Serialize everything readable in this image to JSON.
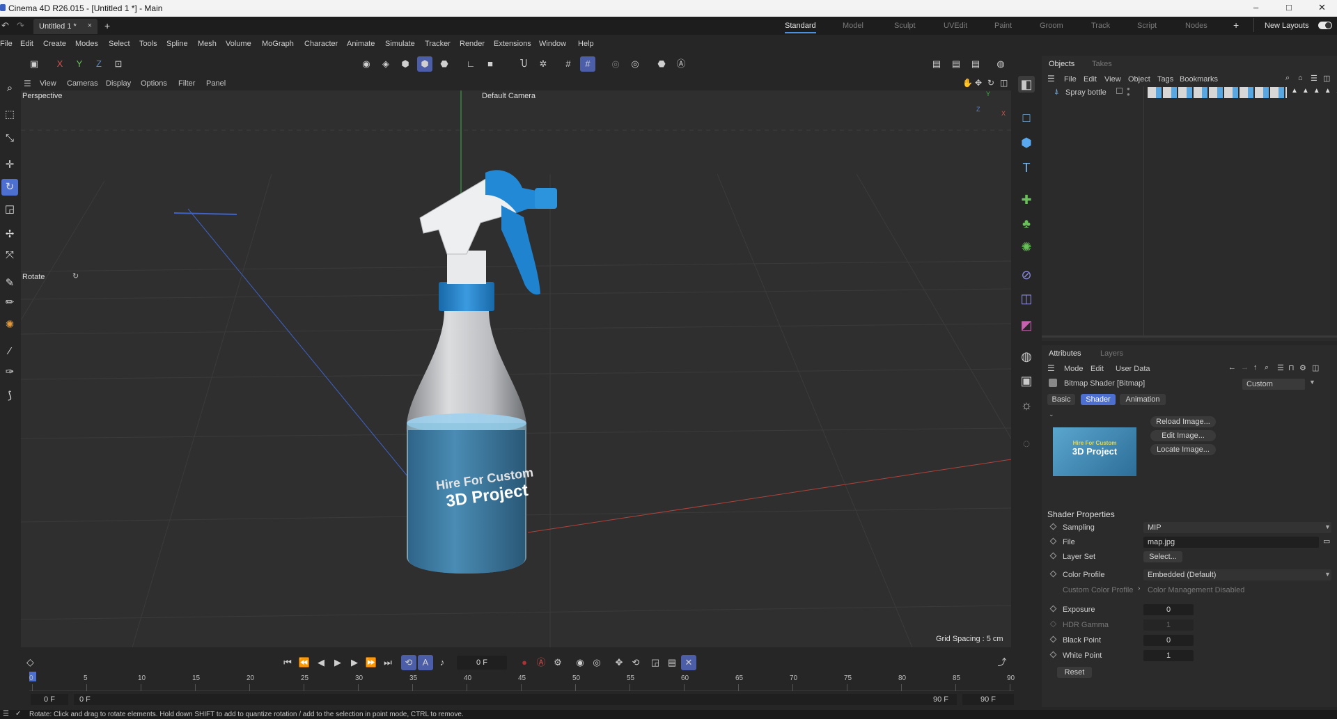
{
  "window": {
    "title": "Cinema 4D R26.015 - [Untitled 1 *] - Main",
    "min": "–",
    "max": "□",
    "close": "✕"
  },
  "tabbar": {
    "doc_tab": "Untitled 1 *",
    "doc_close": "×",
    "add": "+",
    "layouts": [
      "Standard",
      "Model",
      "Sculpt",
      "UVEdit",
      "Paint",
      "Groom",
      "Track",
      "Script",
      "Nodes"
    ],
    "layouts_add": "+",
    "new_layouts": "New Layouts"
  },
  "menu": [
    "File",
    "Edit",
    "Create",
    "Modes",
    "Select",
    "Tools",
    "Spline",
    "Mesh",
    "Volume",
    "MoGraph",
    "Character",
    "Animate",
    "Simulate",
    "Tracker",
    "Render",
    "Extensions",
    "Window",
    "Help"
  ],
  "toolbar": {
    "x": "X",
    "y": "Y",
    "z": "Z"
  },
  "viewport_menu": [
    "View",
    "Cameras",
    "Display",
    "Options",
    "Filter",
    "Panel"
  ],
  "viewport": {
    "name": "Perspective",
    "camera": "Default Camera",
    "tool_label": "Rotate",
    "grid_spacing": "Grid Spacing : 5 cm",
    "label_line1": "Hire For Custom",
    "label_line2": "3D Project",
    "axis_y": "Y",
    "axis_z": "Z",
    "axis_x": "X"
  },
  "objects": {
    "tabs": [
      "Objects",
      "Takes"
    ],
    "menu": [
      "File",
      "Edit",
      "View",
      "Object",
      "Tags",
      "Bookmarks"
    ],
    "item": "Spray bottle"
  },
  "attributes": {
    "tabs": [
      "Attributes",
      "Layers"
    ],
    "menu": [
      "Mode",
      "Edit",
      "User Data"
    ],
    "header": "Bitmap Shader [Bitmap]",
    "preset": "Custom",
    "subtabs": [
      "Basic",
      "Shader",
      "Animation"
    ],
    "image_buttons": [
      "Reload Image...",
      "Edit Image...",
      "Locate Image..."
    ],
    "thumb_line1": "Hire For Custom",
    "thumb_line2": "3D Project",
    "section": "Shader Properties",
    "props": {
      "sampling": {
        "label": "Sampling",
        "value": "MIP"
      },
      "file": {
        "label": "File",
        "value": "map.jpg"
      },
      "layer_set": {
        "label": "Layer Set",
        "value": "Select..."
      },
      "color_profile": {
        "label": "Color Profile",
        "value": "Embedded (Default)"
      },
      "custom_color_profile": {
        "label": "Custom Color Profile",
        "value": "Color Management Disabled"
      },
      "exposure": {
        "label": "Exposure",
        "value": "0"
      },
      "hdr_gamma": {
        "label": "HDR Gamma",
        "value": "1"
      },
      "black_point": {
        "label": "Black Point",
        "value": "0"
      },
      "white_point": {
        "label": "White Point",
        "value": "1"
      }
    },
    "reset": "Reset"
  },
  "timeline": {
    "current_frame": "0 F",
    "ticks": [
      "0",
      "5",
      "10",
      "15",
      "20",
      "25",
      "30",
      "35",
      "40",
      "45",
      "50",
      "55",
      "60",
      "65",
      "70",
      "75",
      "80",
      "85",
      "90"
    ],
    "range_start": "0 F",
    "range_start2": "0 F",
    "range_end": "90 F",
    "range_end2": "90 F"
  },
  "status": "Rotate: Click and drag to rotate elements. Hold down SHIFT to add to quantize rotation / add to the selection in point mode, CTRL to remove.",
  "colors": {
    "accent": "#4d6fd0",
    "bottle_label": "#3f7fa6",
    "trigger_blue": "#1f83d0",
    "grid_x_axis": "#b0443c",
    "grid_z_axis": "#3f63c8",
    "grid_y_axis": "#3eb045"
  }
}
